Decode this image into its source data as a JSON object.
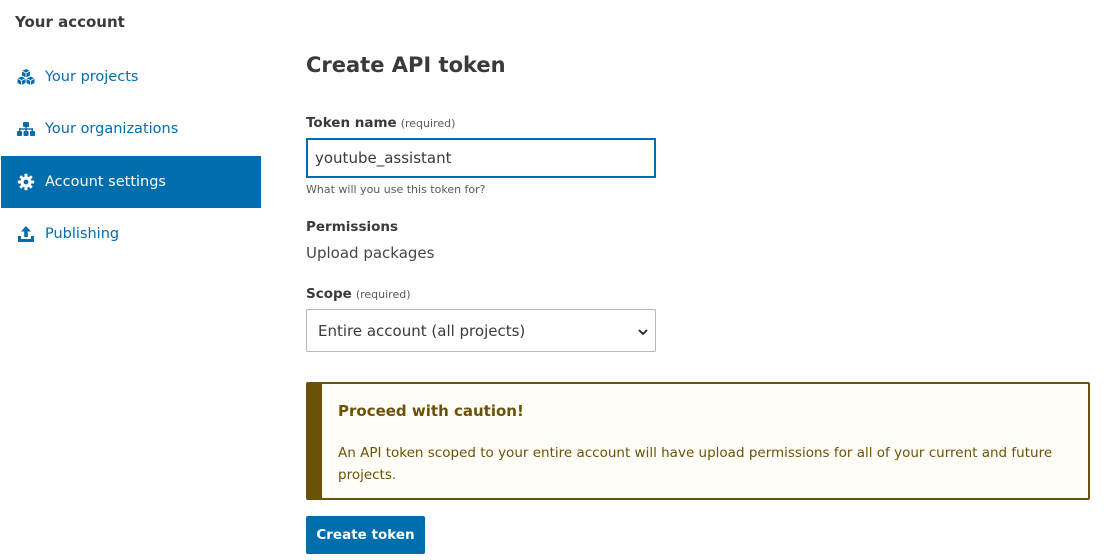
{
  "sidebar": {
    "title": "Your account",
    "items": [
      {
        "label": "Your projects",
        "icon": "cubes-icon",
        "active": false
      },
      {
        "label": "Your organizations",
        "icon": "sitemap-icon",
        "active": false
      },
      {
        "label": "Account settings",
        "icon": "gear-icon",
        "active": true
      },
      {
        "label": "Publishing",
        "icon": "upload-icon",
        "active": false
      }
    ]
  },
  "main": {
    "title": "Create API token",
    "token_name": {
      "label": "Token name",
      "required": "(required)",
      "value": "youtube_assistant",
      "help": "What will you use this token for?"
    },
    "permissions": {
      "label": "Permissions",
      "value": "Upload packages"
    },
    "scope": {
      "label": "Scope",
      "required": "(required)",
      "selected": "Entire account (all projects)"
    },
    "caution": {
      "title": "Proceed with caution!",
      "text": "An API token scoped to your entire account will have upload permissions for all of your current and future projects."
    },
    "create_button": "Create token"
  },
  "colors": {
    "primary": "#006dad",
    "caution": "#6b5208"
  }
}
